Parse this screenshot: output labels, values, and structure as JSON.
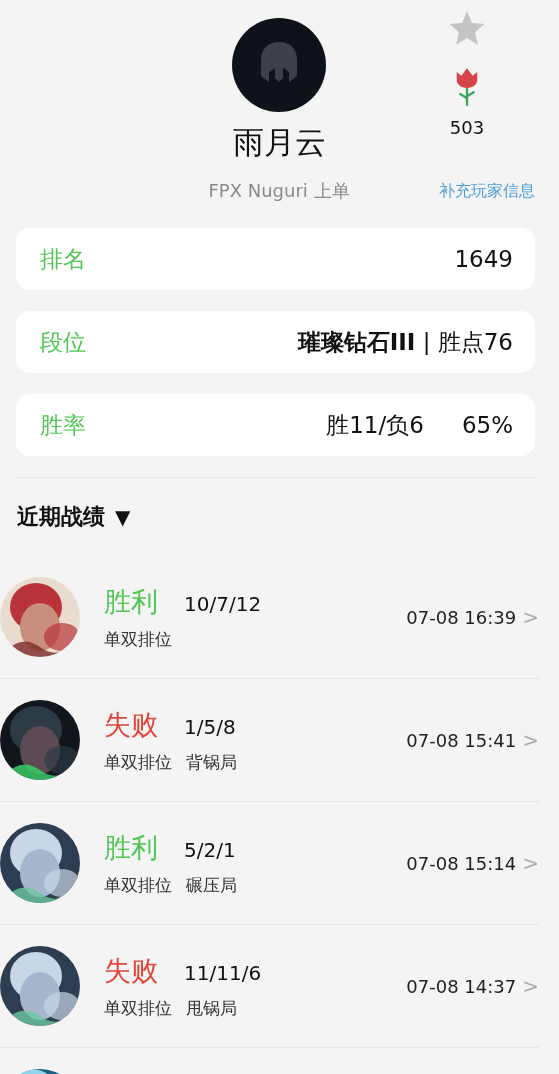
{
  "profile": {
    "name": "雨月云",
    "subtitle": "FPX Nuguri 上单",
    "flower_count": "503",
    "link": "补充玩家信息",
    "favorited": false
  },
  "stats": [
    {
      "label": "排名",
      "value": "1649"
    },
    {
      "label": "段位",
      "value": "**璀璨钻石III** | 胜点76"
    },
    {
      "label": "胜率",
      "value": "胜11/负6",
      "extra": "65%"
    }
  ],
  "recent": {
    "title": "近期战绩",
    "toggle": "▼"
  },
  "matches": [
    {
      "result": "胜利",
      "win": true,
      "kda": "10/7/12",
      "tags": [
        "单双排位"
      ],
      "time": "07-08 16:39",
      "chevron": ">"
    },
    {
      "result": "失败",
      "win": false,
      "kda": "1/5/8",
      "tags": [
        "单双排位",
        "背锅局"
      ],
      "time": "07-08 15:41",
      "chevron": ">"
    },
    {
      "result": "胜利",
      "win": true,
      "kda": "5/2/1",
      "tags": [
        "单双排位",
        "碾压局"
      ],
      "time": "07-08 15:14",
      "chevron": ">"
    },
    {
      "result": "失败",
      "win": false,
      "kda": "11/11/6",
      "tags": [
        "单双排位",
        "甩锅局"
      ],
      "time": "07-08 14:37",
      "chevron": ">"
    }
  ]
}
